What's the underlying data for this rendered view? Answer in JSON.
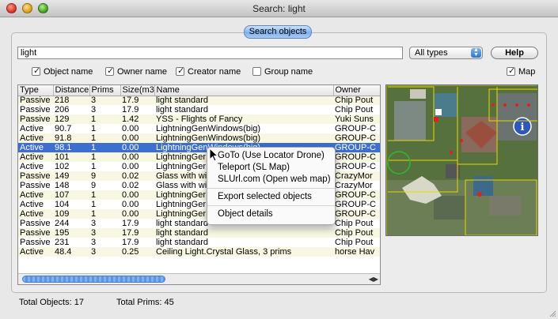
{
  "window": {
    "title": "Search: light"
  },
  "tab": {
    "label": "Search objects"
  },
  "search": {
    "value": "light"
  },
  "type_filter": {
    "selected": "All types"
  },
  "help": {
    "label": "Help"
  },
  "checkboxes": {
    "object_name": {
      "label": "Object name",
      "checked": true
    },
    "owner_name": {
      "label": "Owner name",
      "checked": true
    },
    "creator_name": {
      "label": "Creator name",
      "checked": true
    },
    "group_name": {
      "label": "Group name",
      "checked": false
    },
    "map": {
      "label": "Map",
      "checked": true
    }
  },
  "table": {
    "columns": [
      "Type",
      "Distance",
      "Prims",
      "Size(m3)",
      "Name",
      "Owner"
    ],
    "rows": [
      [
        "Passive",
        "218",
        "3",
        "17.9",
        "light standard",
        "Chip Pout"
      ],
      [
        "Passive",
        "206",
        "3",
        "17.9",
        "light standard",
        "Chip Pout"
      ],
      [
        "Passive",
        "129",
        "1",
        "1.42",
        "YSS - Flights of Fancy",
        "Yuki Suns"
      ],
      [
        "Active",
        "90.7",
        "1",
        "0.00",
        "LightningGenWindows(big)",
        "GROUP-C"
      ],
      [
        "Active",
        "91.8",
        "1",
        "0.00",
        "LightningGenWindows(big)",
        "GROUP-C"
      ],
      [
        "Active",
        "98.1",
        "1",
        "0.00",
        "LightningGenWindows(big)",
        "GROUP-C"
      ],
      [
        "Active",
        "101",
        "1",
        "0.00",
        "LightningGer",
        "GROUP-C"
      ],
      [
        "Active",
        "102",
        "1",
        "0.00",
        "LightningGer",
        "GROUP-C"
      ],
      [
        "Passive",
        "149",
        "9",
        "0.02",
        "Glass with wi",
        "CrazyMor"
      ],
      [
        "Passive",
        "148",
        "9",
        "0.02",
        "Glass with wi",
        "CrazyMor"
      ],
      [
        "Active",
        "107",
        "1",
        "0.00",
        "LightningGer",
        "GROUP-C"
      ],
      [
        "Active",
        "104",
        "1",
        "0.00",
        "LightningGer",
        "GROUP-C"
      ],
      [
        "Active",
        "109",
        "1",
        "0.00",
        "LightningGer",
        "GROUP-C"
      ],
      [
        "Passive",
        "244",
        "3",
        "17.9",
        "light standard",
        "Chip Pout"
      ],
      [
        "Passive",
        "195",
        "3",
        "17.9",
        "light standard",
        "Chip Pout"
      ],
      [
        "Passive",
        "231",
        "3",
        "17.9",
        "light standard",
        "Chip Pout"
      ],
      [
        "Active",
        "48.4",
        "3",
        "0.25",
        "Ceiling Light.Crystal Glass, 3 prims",
        "horse Hav"
      ]
    ],
    "selected_row": 5
  },
  "context_menu": {
    "items": [
      "GoTo (Use Locator Drone)",
      "Teleport (SL Map)",
      "SLUrl.com (Open web map)",
      "Export selected objects",
      "Object details"
    ]
  },
  "status": {
    "total_objects": "Total Objects: 17",
    "total_prims": "Total Prims: 45"
  },
  "colors": {
    "selection": "#3c6fd1",
    "row_alt": "#f7f7e2",
    "accent": "#7fb0ec"
  }
}
